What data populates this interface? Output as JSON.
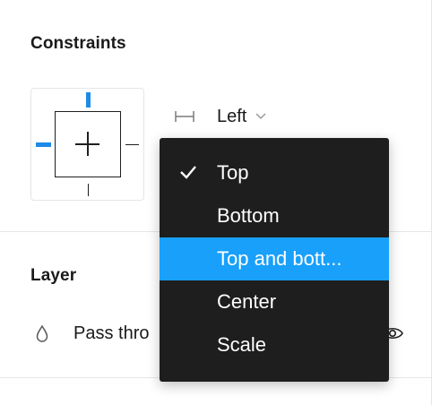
{
  "constraints": {
    "title": "Constraints",
    "horizontal": {
      "selected_label": "Left"
    }
  },
  "layer": {
    "title": "Layer",
    "blend_mode": "Pass thro"
  },
  "vertical_menu": {
    "items": [
      {
        "label": "Top",
        "checked": true,
        "highlighted": false
      },
      {
        "label": "Bottom",
        "checked": false,
        "highlighted": false
      },
      {
        "label": "Top and bott...",
        "checked": false,
        "highlighted": true
      },
      {
        "label": "Center",
        "checked": false,
        "highlighted": false
      },
      {
        "label": "Scale",
        "checked": false,
        "highlighted": false
      }
    ]
  },
  "colors": {
    "accent_blue": "#18a0fb",
    "constraint_active": "#1c8be8",
    "menu_background": "#1e1e1e"
  },
  "icons": {
    "check": "check-icon",
    "horizontal_constraint": "horizontal-constraint-icon",
    "chevron": "chevron-down-icon",
    "blend": "blend-drop-icon",
    "visibility": "eye-icon"
  }
}
